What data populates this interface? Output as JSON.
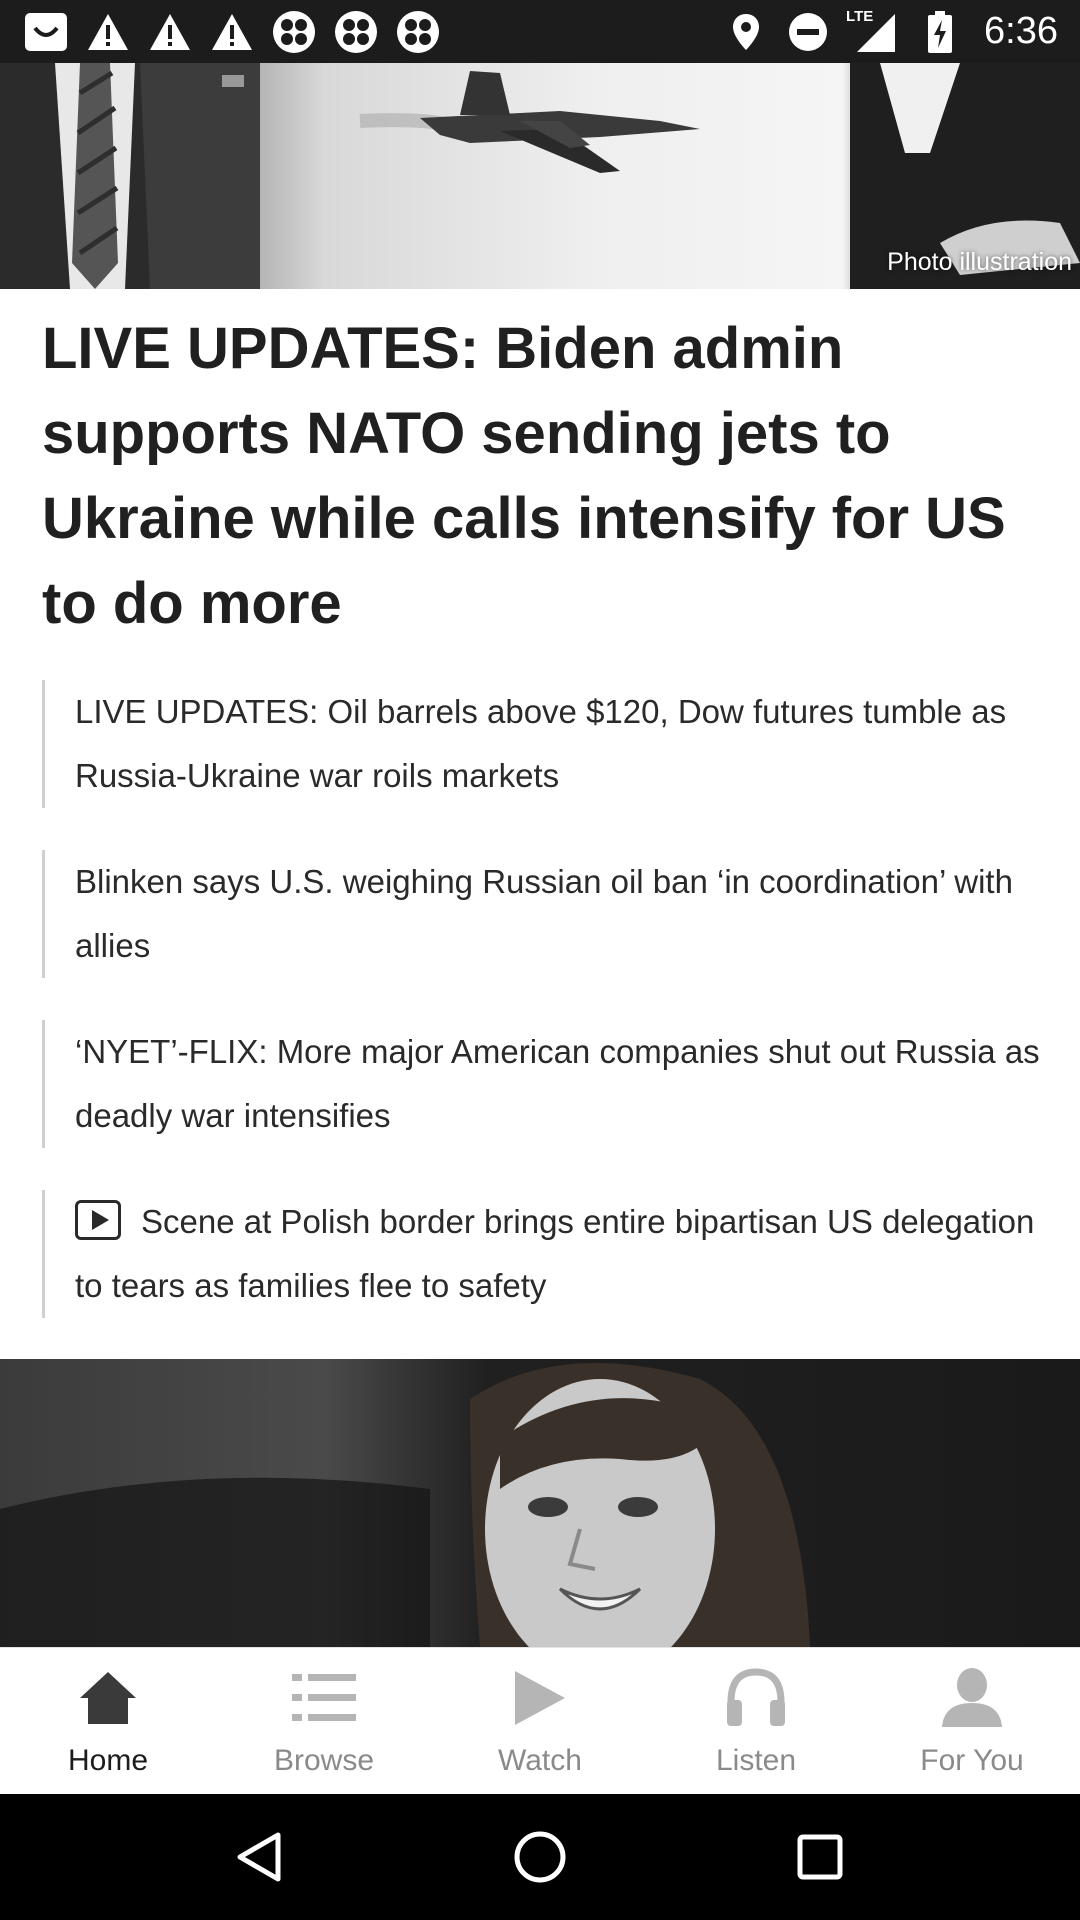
{
  "status_bar": {
    "time": "6:36",
    "network": "LTE",
    "left_icons": [
      "smile-notification-icon",
      "warning-icon",
      "warning-icon",
      "warning-icon",
      "app-grid-icon",
      "app-grid-icon",
      "app-grid-icon"
    ],
    "right_icons": [
      "location-icon",
      "do-not-disturb-icon",
      "signal-icon",
      "battery-charging-icon"
    ]
  },
  "hero": {
    "credit": "Photo illustration"
  },
  "headline": "LIVE UPDATES: Biden admin supports NATO sending jets to Ukraine while calls intensify for US to do more",
  "related": [
    {
      "text": "LIVE UPDATES: Oil barrels above $120, Dow futures tumble as Russia-Ukraine war roils markets",
      "video": false
    },
    {
      "text": "Blinken says U.S. weighing Russian oil ban ‘in coordination’ with allies",
      "video": false
    },
    {
      "text": "‘NYET’-FLIX: More major American companies shut out Russia as deadly war intensifies",
      "video": false
    },
    {
      "text": "Scene at Polish border brings entire bipartisan US delegation to tears as families flee to safety",
      "video": true
    }
  ],
  "bottom_nav": {
    "items": [
      {
        "label": "Home",
        "icon": "home-icon",
        "active": true
      },
      {
        "label": "Browse",
        "icon": "list-icon",
        "active": false
      },
      {
        "label": "Watch",
        "icon": "play-icon",
        "active": false
      },
      {
        "label": "Listen",
        "icon": "headphones-icon",
        "active": false
      },
      {
        "label": "For You",
        "icon": "person-icon",
        "active": false
      }
    ]
  },
  "system_nav": [
    "back-icon",
    "home-circle-icon",
    "recents-icon"
  ],
  "colors": {
    "status_bar_bg": "#1c1c1c",
    "active_nav": "#1c1c1c",
    "inactive_nav": "#8a8a8a"
  }
}
